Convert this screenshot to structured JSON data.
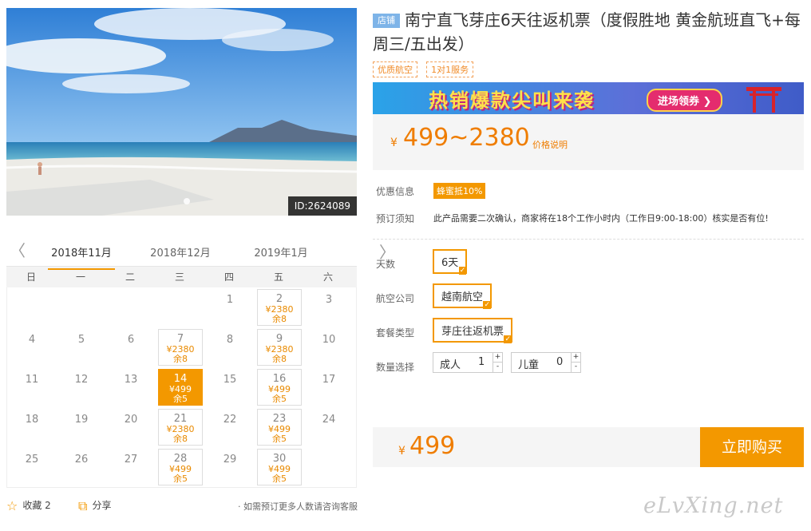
{
  "hero": {
    "id_label": "ID:2624089"
  },
  "calendar": {
    "prev_arrow": "〈",
    "next_arrow": "〉",
    "months": [
      "2018年11月",
      "2018年12月",
      "2019年1月"
    ],
    "weekdays": [
      "日",
      "一",
      "二",
      "三",
      "四",
      "五",
      "六"
    ],
    "weeks": [
      [
        {
          "d": ""
        },
        {
          "d": ""
        },
        {
          "d": ""
        },
        {
          "d": ""
        },
        {
          "d": "1"
        },
        {
          "d": "2",
          "price": "¥2380",
          "stock": "余8"
        },
        {
          "d": "3"
        }
      ],
      [
        {
          "d": "4"
        },
        {
          "d": "5"
        },
        {
          "d": "6"
        },
        {
          "d": "7",
          "price": "¥2380",
          "stock": "余8"
        },
        {
          "d": "8"
        },
        {
          "d": "9",
          "price": "¥2380",
          "stock": "余8"
        },
        {
          "d": "10"
        }
      ],
      [
        {
          "d": "11"
        },
        {
          "d": "12"
        },
        {
          "d": "13"
        },
        {
          "d": "14",
          "price": "¥499",
          "stock": "余5",
          "selected": true
        },
        {
          "d": "15"
        },
        {
          "d": "16",
          "price": "¥499",
          "stock": "余5"
        },
        {
          "d": "17"
        }
      ],
      [
        {
          "d": "18"
        },
        {
          "d": "19"
        },
        {
          "d": "20"
        },
        {
          "d": "21",
          "price": "¥2380",
          "stock": "余8"
        },
        {
          "d": "22"
        },
        {
          "d": "23",
          "price": "¥499",
          "stock": "余5"
        },
        {
          "d": "24"
        }
      ],
      [
        {
          "d": "25"
        },
        {
          "d": "26"
        },
        {
          "d": "27"
        },
        {
          "d": "28",
          "price": "¥499",
          "stock": "余5"
        },
        {
          "d": "29"
        },
        {
          "d": "30",
          "price": "¥499",
          "stock": "余5"
        },
        {
          "d": ""
        }
      ]
    ]
  },
  "footer": {
    "favorite_label": "收藏 2",
    "share_label": "分享",
    "note": "· 如需预订更多人数请咨询客服"
  },
  "product": {
    "shop_badge": "店铺",
    "title": "南宁直飞芽庄6天往返机票（度假胜地 黄金航班直飞+每周三/五出发）",
    "tags": [
      "优质航空",
      "1对1服务"
    ],
    "banner_text": "热销爆款尖叫来袭",
    "banner_button": "进场领券 ❯",
    "price_currency": "¥",
    "price_range": "499~2380",
    "price_explain": "价格说明"
  },
  "info": {
    "discount_label": "优惠信息",
    "discount_badge": "蜂蜜抵10%",
    "notice_label": "预订须知",
    "notice_text": "此产品需要二次确认，商家将在18个工作小时内（工作日9:00-18:00）核实是否有位!"
  },
  "options": {
    "days_label": "天数",
    "days_value": "6天",
    "airline_label": "航空公司",
    "airline_value": "越南航空",
    "package_label": "套餐类型",
    "package_value": "芽庄往返机票",
    "qty_label": "数量选择",
    "adult_label": "成人",
    "adult_qty": "1",
    "child_label": "儿童",
    "child_qty": "0",
    "plus": "+",
    "minus": "-"
  },
  "buy": {
    "currency": "¥",
    "amount": "499",
    "button": "立即购买"
  },
  "watermark": "eLvXing.net",
  "colors": {
    "accent": "#f39800",
    "price": "#ef7d00"
  }
}
